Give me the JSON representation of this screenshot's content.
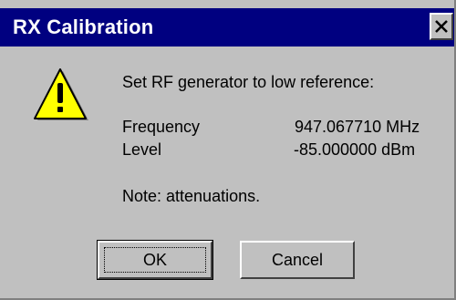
{
  "window": {
    "title": "RX Calibration",
    "close_glyph": "close-icon"
  },
  "message": {
    "icon": "warning-icon",
    "instruction": "Set RF generator to low reference:",
    "frequency_label": "Frequency",
    "frequency_value": "947.067710 MHz",
    "level_label": "Level",
    "level_value": "-85.000000 dBm",
    "note": "Note: attenuations."
  },
  "buttons": {
    "ok_label": "OK",
    "cancel_label": "Cancel"
  },
  "colors": {
    "titlebar": "#000080",
    "face": "#c0c0c0",
    "warning_fill": "#ffff00"
  }
}
